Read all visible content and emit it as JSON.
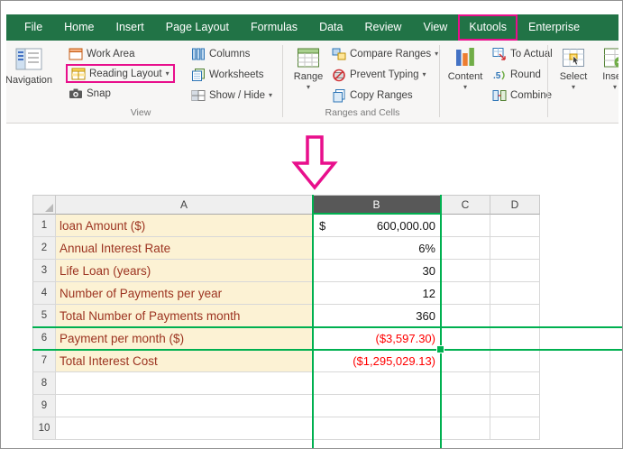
{
  "tab_bar": {
    "tabs": [
      "File",
      "Home",
      "Insert",
      "Page Layout",
      "Formulas",
      "Data",
      "Review",
      "View",
      "Kutools",
      "Enterprise"
    ],
    "highlighted_tab": "Kutools"
  },
  "ribbon": {
    "navigation": "Navigation",
    "work_area": "Work Area",
    "reading_layout": "Reading Layout",
    "snap": "Snap",
    "view_group_label": "View",
    "columns": "Columns",
    "worksheets": "Worksheets",
    "show_hide": "Show / Hide",
    "range": "Range",
    "compare_ranges": "Compare Ranges",
    "prevent_typing": "Prevent Typing",
    "copy_ranges": "Copy Ranges",
    "ranges_group_label": "Ranges and Cells",
    "content": "Content",
    "to_actual": "To Actual",
    "round": "Round",
    "combine": "Combine",
    "select": "Select",
    "insert": "Insert"
  },
  "sheet": {
    "column_headers": [
      "A",
      "B",
      "C",
      "D"
    ],
    "selected_column": "B",
    "active_cell": "B6",
    "rows": [
      {
        "num": "1",
        "label": "loan Amount ($)",
        "currency": "$",
        "value": "600,000.00",
        "red": false
      },
      {
        "num": "2",
        "label": "Annual Interest Rate",
        "value": "6%",
        "red": false
      },
      {
        "num": "3",
        "label": "Life Loan (years)",
        "value": "30",
        "red": false
      },
      {
        "num": "4",
        "label": "Number of Payments per year",
        "value": "12",
        "red": false
      },
      {
        "num": "5",
        "label": "Total Number of Payments month",
        "value": "360",
        "red": false
      },
      {
        "num": "6",
        "label": "Payment per month ($)",
        "value": "($3,597.30)",
        "red": true
      },
      {
        "num": "7",
        "label": "Total Interest Cost",
        "value": "($1,295,029.13)",
        "red": true
      },
      {
        "num": "8",
        "label": "",
        "value": "",
        "red": false
      },
      {
        "num": "9",
        "label": "",
        "value": "",
        "red": false
      },
      {
        "num": "10",
        "label": "",
        "value": "",
        "red": false
      }
    ]
  },
  "colors": {
    "excel_green": "#217346",
    "annotation_magenta": "#e80f8c",
    "reading_layout_green": "#00b050",
    "loan_label_bg": "#fcf2d4",
    "loan_label_text": "#9c3320",
    "negative_value_red": "#ff0000"
  }
}
